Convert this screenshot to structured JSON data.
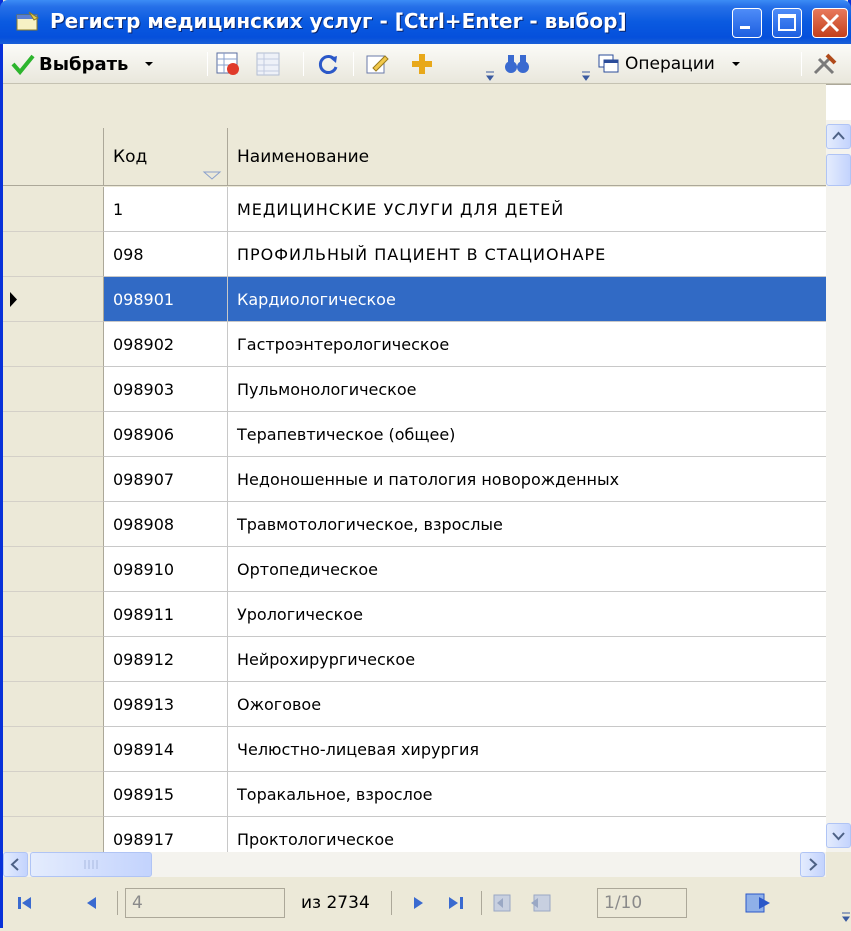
{
  "window": {
    "title": "Регистр медицинских услуг - [Ctrl+Enter - выбор]"
  },
  "toolbar": {
    "select_label": "Выбрать",
    "operations_label": "Операции"
  },
  "grid": {
    "columns": {
      "code": "Код",
      "name": "Наименование"
    },
    "rows": [
      {
        "code": "1",
        "name": "МЕДИЦИНСКИЕ УСЛУГИ ДЛЯ ДЕТЕЙ"
      },
      {
        "code": "098",
        "name": "ПРОФИЛЬНЫЙ ПАЦИЕНТ В СТАЦИОНАРЕ"
      },
      {
        "code": "098901",
        "name": "Кардиологическое"
      },
      {
        "code": "098902",
        "name": "Гастроэнтерологическое"
      },
      {
        "code": "098903",
        "name": "Пульмонологическое"
      },
      {
        "code": "098906",
        "name": "Терапевтическое (общее)"
      },
      {
        "code": "098907",
        "name": "Недоношенные и патология новорожденных"
      },
      {
        "code": "098908",
        "name": "Травмотологическое, взрослые"
      },
      {
        "code": "098910",
        "name": "Ортопедическое"
      },
      {
        "code": "098911",
        "name": "Урологическое"
      },
      {
        "code": "098912",
        "name": "Нейрохирургическое"
      },
      {
        "code": "098913",
        "name": "Ожоговое"
      },
      {
        "code": "098914",
        "name": "Челюстно-лицевая хирургия"
      },
      {
        "code": "098915",
        "name": "Торакальное, взрослое"
      },
      {
        "code": "098917",
        "name": "Проктологическое"
      }
    ]
  },
  "navigator": {
    "current_record": "4",
    "total_label": "из 2734",
    "page_value": "1/10"
  },
  "colors": {
    "selection": "#316ac5",
    "titlebar": "#0a5ae0"
  }
}
